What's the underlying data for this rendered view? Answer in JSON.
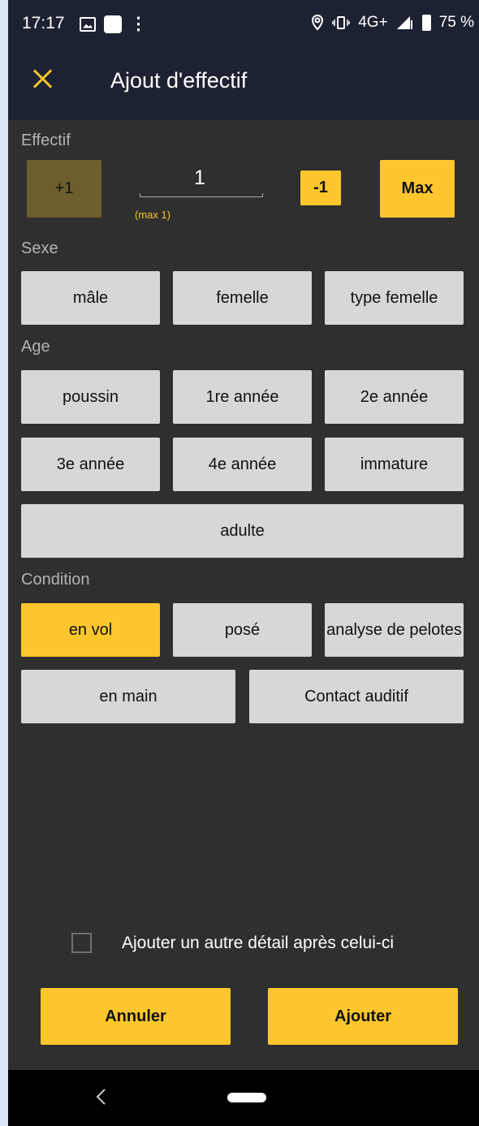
{
  "status_bar": {
    "time": "17:17",
    "network": "4G+",
    "battery_percent": "75 %",
    "icons": [
      "image-icon",
      "app-icon",
      "more-icon",
      "location-icon",
      "vibrate-icon",
      "signal-icon",
      "battery-icon"
    ]
  },
  "app_bar": {
    "title": "Ajout d'effectif",
    "close_icon": "close-icon",
    "accent_color": "#f7c32a"
  },
  "effectif": {
    "label": "Effectif",
    "plus_label": "+1",
    "value": "1",
    "max_hint": "(max 1)",
    "minus_label": "-1",
    "max_label": "Max"
  },
  "sexe": {
    "label": "Sexe",
    "options": [
      "mâle",
      "femelle",
      "type femelle"
    ]
  },
  "age": {
    "label": "Age",
    "options": [
      "poussin",
      "1re année",
      "2e année",
      "3e année",
      "4e année",
      "immature",
      "adulte"
    ]
  },
  "condition": {
    "label": "Condition",
    "options": [
      "en vol",
      "posé",
      "analyse de pelotes",
      "en main",
      "Contact auditif"
    ],
    "selected": "en vol"
  },
  "footer": {
    "checkbox_label": "Ajouter un autre détail après celui-ci",
    "checkbox_checked": false,
    "cancel_label": "Annuler",
    "add_label": "Ajouter"
  },
  "colors": {
    "background": "#2f2f2f",
    "header": "#1d2233",
    "button": "#d7d7d7",
    "accent": "#fdc62d"
  }
}
